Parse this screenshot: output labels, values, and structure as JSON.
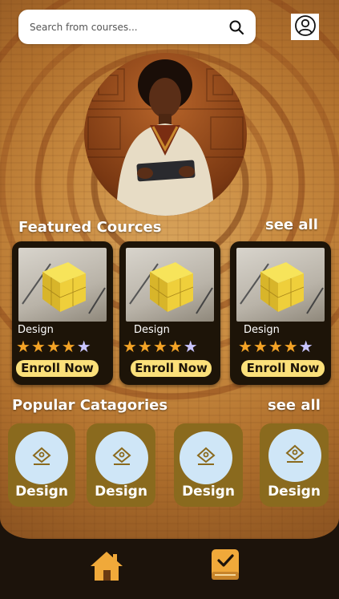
{
  "search": {
    "placeholder": "Search from courses..."
  },
  "icons": {
    "search": "search-icon",
    "profile": "user-circle-icon",
    "home": "home-icon",
    "courses": "book-check-icon",
    "category": "stack-icon"
  },
  "colors": {
    "card_bg": "#1d1408",
    "enroll_bg": "#fbe07a",
    "star_filled": "#f3a326",
    "star_empty": "#c9c5ff",
    "category_tile": "#8a6a1e",
    "category_circle": "#cfe6f7",
    "nav_bg": "#1c130b",
    "nav_accent": "#f0a93a"
  },
  "featured": {
    "title": "Featured Cources",
    "see_all": "see all",
    "courses": [
      {
        "category": "Design",
        "rating": 4,
        "max_rating": 5,
        "stars_filled": "★★★★",
        "stars_empty": "★",
        "enroll_label": "Enroll Now"
      },
      {
        "category": "Design",
        "rating": 4,
        "max_rating": 5,
        "stars_filled": "★★★★",
        "stars_empty": "★",
        "enroll_label": "Enroll Now"
      },
      {
        "category": "Design",
        "rating": 4,
        "max_rating": 5,
        "stars_filled": "★★★★",
        "stars_empty": "★",
        "enroll_label": "Enroll Now"
      }
    ]
  },
  "popular": {
    "title": "Popular Catagories",
    "see_all": "see all",
    "categories": [
      {
        "label": "Design"
      },
      {
        "label": "Design"
      },
      {
        "label": "Design"
      },
      {
        "label": "Design"
      }
    ]
  }
}
